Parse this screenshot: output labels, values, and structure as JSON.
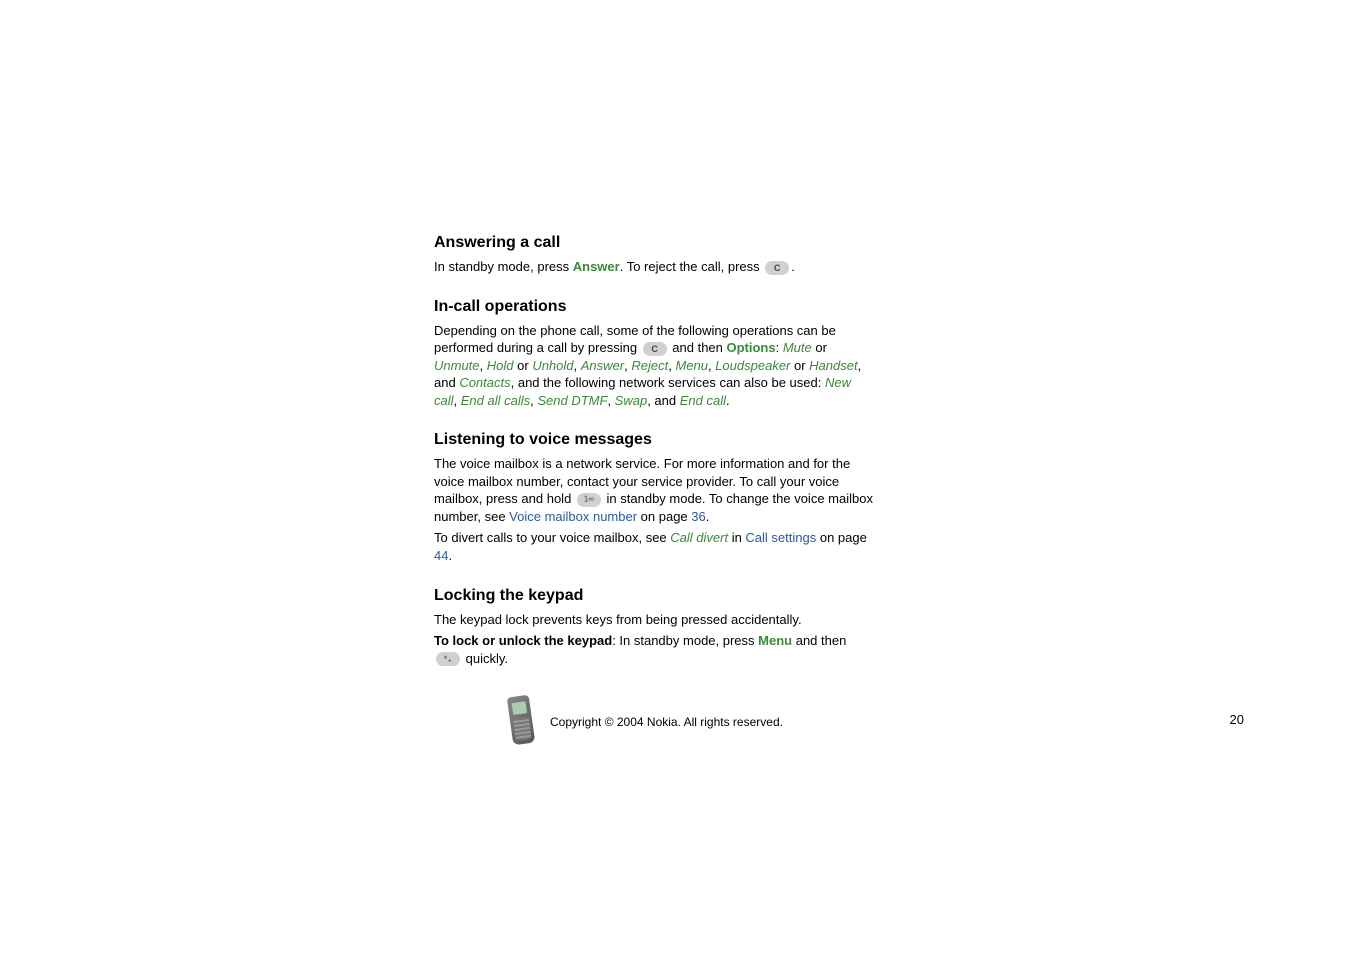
{
  "sections": {
    "answering": {
      "heading": "Answering a call",
      "text_before_answer": "In standby mode, press ",
      "answer": "Answer",
      "text_after_answer": ". To reject the call, press ",
      "period": "."
    },
    "incall": {
      "heading": "In-call operations",
      "p1_start": "Depending on the phone call, some of the following operations can be performed during a call by pressing ",
      "p1_and_then": " and then ",
      "options": "Options",
      "colon_space": ": ",
      "mute": "Mute",
      "or": " or ",
      "unmute": "Unmute",
      "comma_space": ", ",
      "hold": "Hold",
      "unhold": "Unhold",
      "answer": "Answer",
      "reject": "Reject",
      "menu": "Menu",
      "loudspeaker": "Loudspeaker",
      "handset": "Handset",
      "and": ", and ",
      "contacts": "Contacts",
      "p1_after_contacts": ", and the following network services can also be used: ",
      "newcall": "New call",
      "endallcalls": "End all calls",
      "senddtmf": "Send DTMF",
      "swap": "Swap",
      "and2": ", and ",
      "endcall": "End call",
      "period": "."
    },
    "listening": {
      "heading": "Listening to voice messages",
      "p1_start": "The voice mailbox is a network service. For more information and for the voice mailbox number, contact your service provider. To call your voice mailbox, press and hold ",
      "p1_mid": " in standby mode. To change the voice mailbox number, see ",
      "voice_mailbox_number": "Voice mailbox number",
      "on_page": " on page ",
      "page36": "36",
      "period": ".",
      "p2_start": "To divert calls to your voice mailbox, see ",
      "call_divert": "Call divert",
      "in": " in ",
      "call_settings": "Call settings",
      "on_page2": " on page ",
      "page44": "44",
      "period2": "."
    },
    "locking": {
      "heading": "Locking the keypad",
      "p1": "The keypad lock prevents keys from being pressed accidentally.",
      "p2_bold": "To lock or unlock the keypad",
      "p2_after_bold": ": In standby mode, press ",
      "menu": "Menu",
      "and_then": " and then ",
      "quickly": " quickly."
    }
  },
  "footer": {
    "copyright": "Copyright © 2004 Nokia. All rights reserved.",
    "page": "20"
  }
}
